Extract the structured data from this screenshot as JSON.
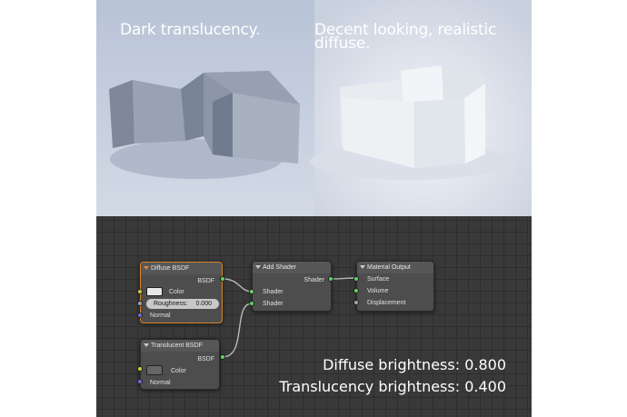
{
  "render": {
    "left_caption": "Dark translucency.",
    "right_caption_line1": "Decent looking, realistic",
    "right_caption_line2": "diffuse."
  },
  "nodes": {
    "diffuse": {
      "title": "Diffuse BSDF",
      "output": "BSDF",
      "color_label": "Color",
      "roughness_label": "Roughness:",
      "roughness_value": "0.000",
      "normal_label": "Normal",
      "swatch_color": "#e6e6e6"
    },
    "translucent": {
      "title": "Translucent BSDF",
      "output": "BSDF",
      "color_label": "Color",
      "normal_label": "Normal",
      "swatch_color": "#666666"
    },
    "add_shader": {
      "title": "Add Shader",
      "output": "Shader",
      "input1": "Shader",
      "input2": "Shader"
    },
    "material_output": {
      "title": "Material Output",
      "surface": "Surface",
      "volume": "Volume",
      "displacement": "Displacement"
    }
  },
  "stats": {
    "diffuse_brightness": "Diffuse brightness: 0.800",
    "translucency_brightness": "Translucency brightness: 0.400"
  },
  "colors": {
    "active_node_border": "#d9822b",
    "shader_socket": "#5fd35f",
    "color_socket": "#cfcf40",
    "float_socket": "#a5a5a5",
    "vector_socket": "#6b6bd6"
  }
}
